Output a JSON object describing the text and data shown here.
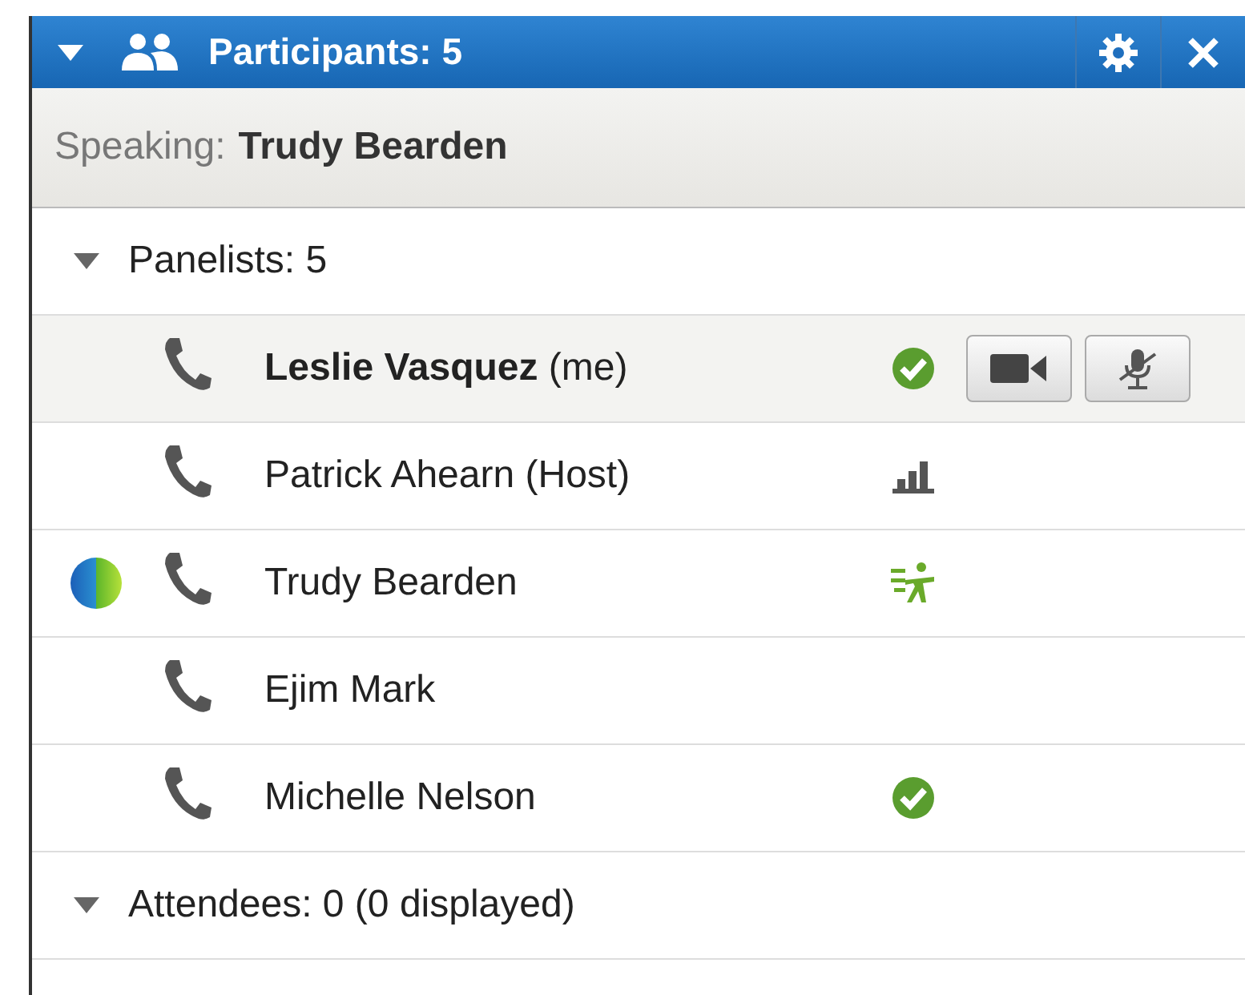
{
  "panel": {
    "title": "Participants: 5",
    "expanded": true
  },
  "speaking": {
    "label": "Speaking:",
    "name": "Trudy Bearden"
  },
  "groups": [
    {
      "label": "Panelists: 5",
      "expanded": true,
      "rows": [
        {
          "name": "**Leslie Vasquez** (me)",
          "selected": true,
          "presenter": false,
          "kind": "check",
          "controls": true
        },
        {
          "name": "Patrick Ahearn (Host)",
          "selected": false,
          "presenter": false,
          "kind": "signal",
          "controls": false
        },
        {
          "name": "Trudy Bearden",
          "selected": false,
          "presenter": true,
          "kind": "raise",
          "controls": false
        },
        {
          "name": "Ejim Mark",
          "selected": false,
          "presenter": false,
          "kind": "plain",
          "controls": false
        },
        {
          "name": "Michelle Nelson",
          "selected": false,
          "presenter": false,
          "kind": "check",
          "controls": false
        }
      ]
    },
    {
      "label": "Attendees: 0 (0 displayed)",
      "expanded": true
    }
  ]
}
